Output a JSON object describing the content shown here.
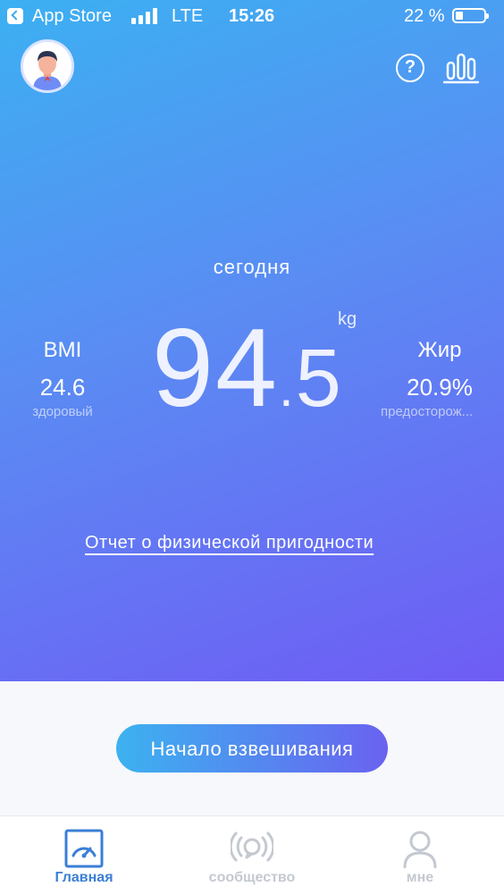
{
  "status_bar": {
    "carrier": "App Store",
    "network": "LTE",
    "time": "15:26",
    "battery": "22 %",
    "battery_level": 0.22
  },
  "header": {
    "avatar_icon": "user-avatar-icon",
    "help_icon": "question-icon",
    "stats_icon": "bar-chart-icon"
  },
  "main": {
    "date_label": "сегодня",
    "weight_int": "94",
    "weight_dot": ".",
    "weight_dec": "5",
    "weight_unit": "kg",
    "bmi": {
      "label": "BMI",
      "value": "24.6",
      "status": "здоровый"
    },
    "fat": {
      "label": "Жир",
      "value": "20.9%",
      "status": "предосторож..."
    },
    "report_link": "Отчет о физической пригодности"
  },
  "actions": {
    "start_weighing": "Начало взвешивания"
  },
  "tabbar": {
    "tabs": [
      {
        "label": "Главная",
        "icon": "scale-gauge-icon",
        "active": true
      },
      {
        "label": "сообщество",
        "icon": "broadcast-icon",
        "active": false
      },
      {
        "label": "мне",
        "icon": "person-icon",
        "active": false
      }
    ]
  },
  "colors": {
    "gradient_start": "#3cb0f2",
    "gradient_end": "#6f5cf4",
    "active_tab": "#3b7fd6",
    "inactive_tab": "#c4c8d0"
  }
}
